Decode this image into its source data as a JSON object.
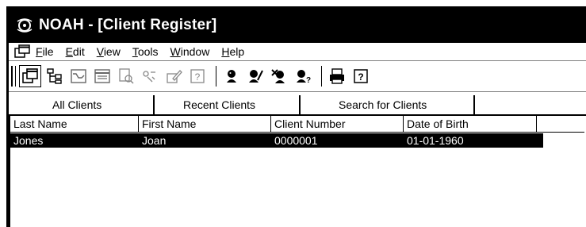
{
  "titlebar": {
    "title": "NOAH - [Client Register]"
  },
  "menubar": {
    "items": [
      {
        "label": "File",
        "key": "F",
        "rest": "ile"
      },
      {
        "label": "Edit",
        "key": "E",
        "rest": "dit"
      },
      {
        "label": "View",
        "key": "V",
        "rest": "iew"
      },
      {
        "label": "Tools",
        "key": "T",
        "rest": "ools"
      },
      {
        "label": "Window",
        "key": "W",
        "rest": "indow"
      },
      {
        "label": "Help",
        "key": "H",
        "rest": "elp"
      }
    ]
  },
  "toolbar": {
    "icons": [
      "open-icon",
      "tree-icon",
      "chart-icon",
      "form-icon",
      "print-preview-icon",
      "transfer-icon",
      "edit-icon",
      "help-icon",
      "client-icon",
      "client-edit-icon",
      "client-delete-icon",
      "client-search-icon",
      "printer-icon",
      "context-help-icon"
    ]
  },
  "tabs": [
    "All Clients",
    "Recent Clients",
    "Search for Clients"
  ],
  "table": {
    "columns": [
      "Last Name",
      "First Name",
      "Client Number",
      "Date of Birth"
    ],
    "rows": [
      [
        "Jones",
        "Joan",
        "0000001",
        "01-01-1960"
      ]
    ]
  },
  "colors": {
    "titlebar": "#000000",
    "selection": "#000000",
    "selection_text": "#ffffff"
  }
}
